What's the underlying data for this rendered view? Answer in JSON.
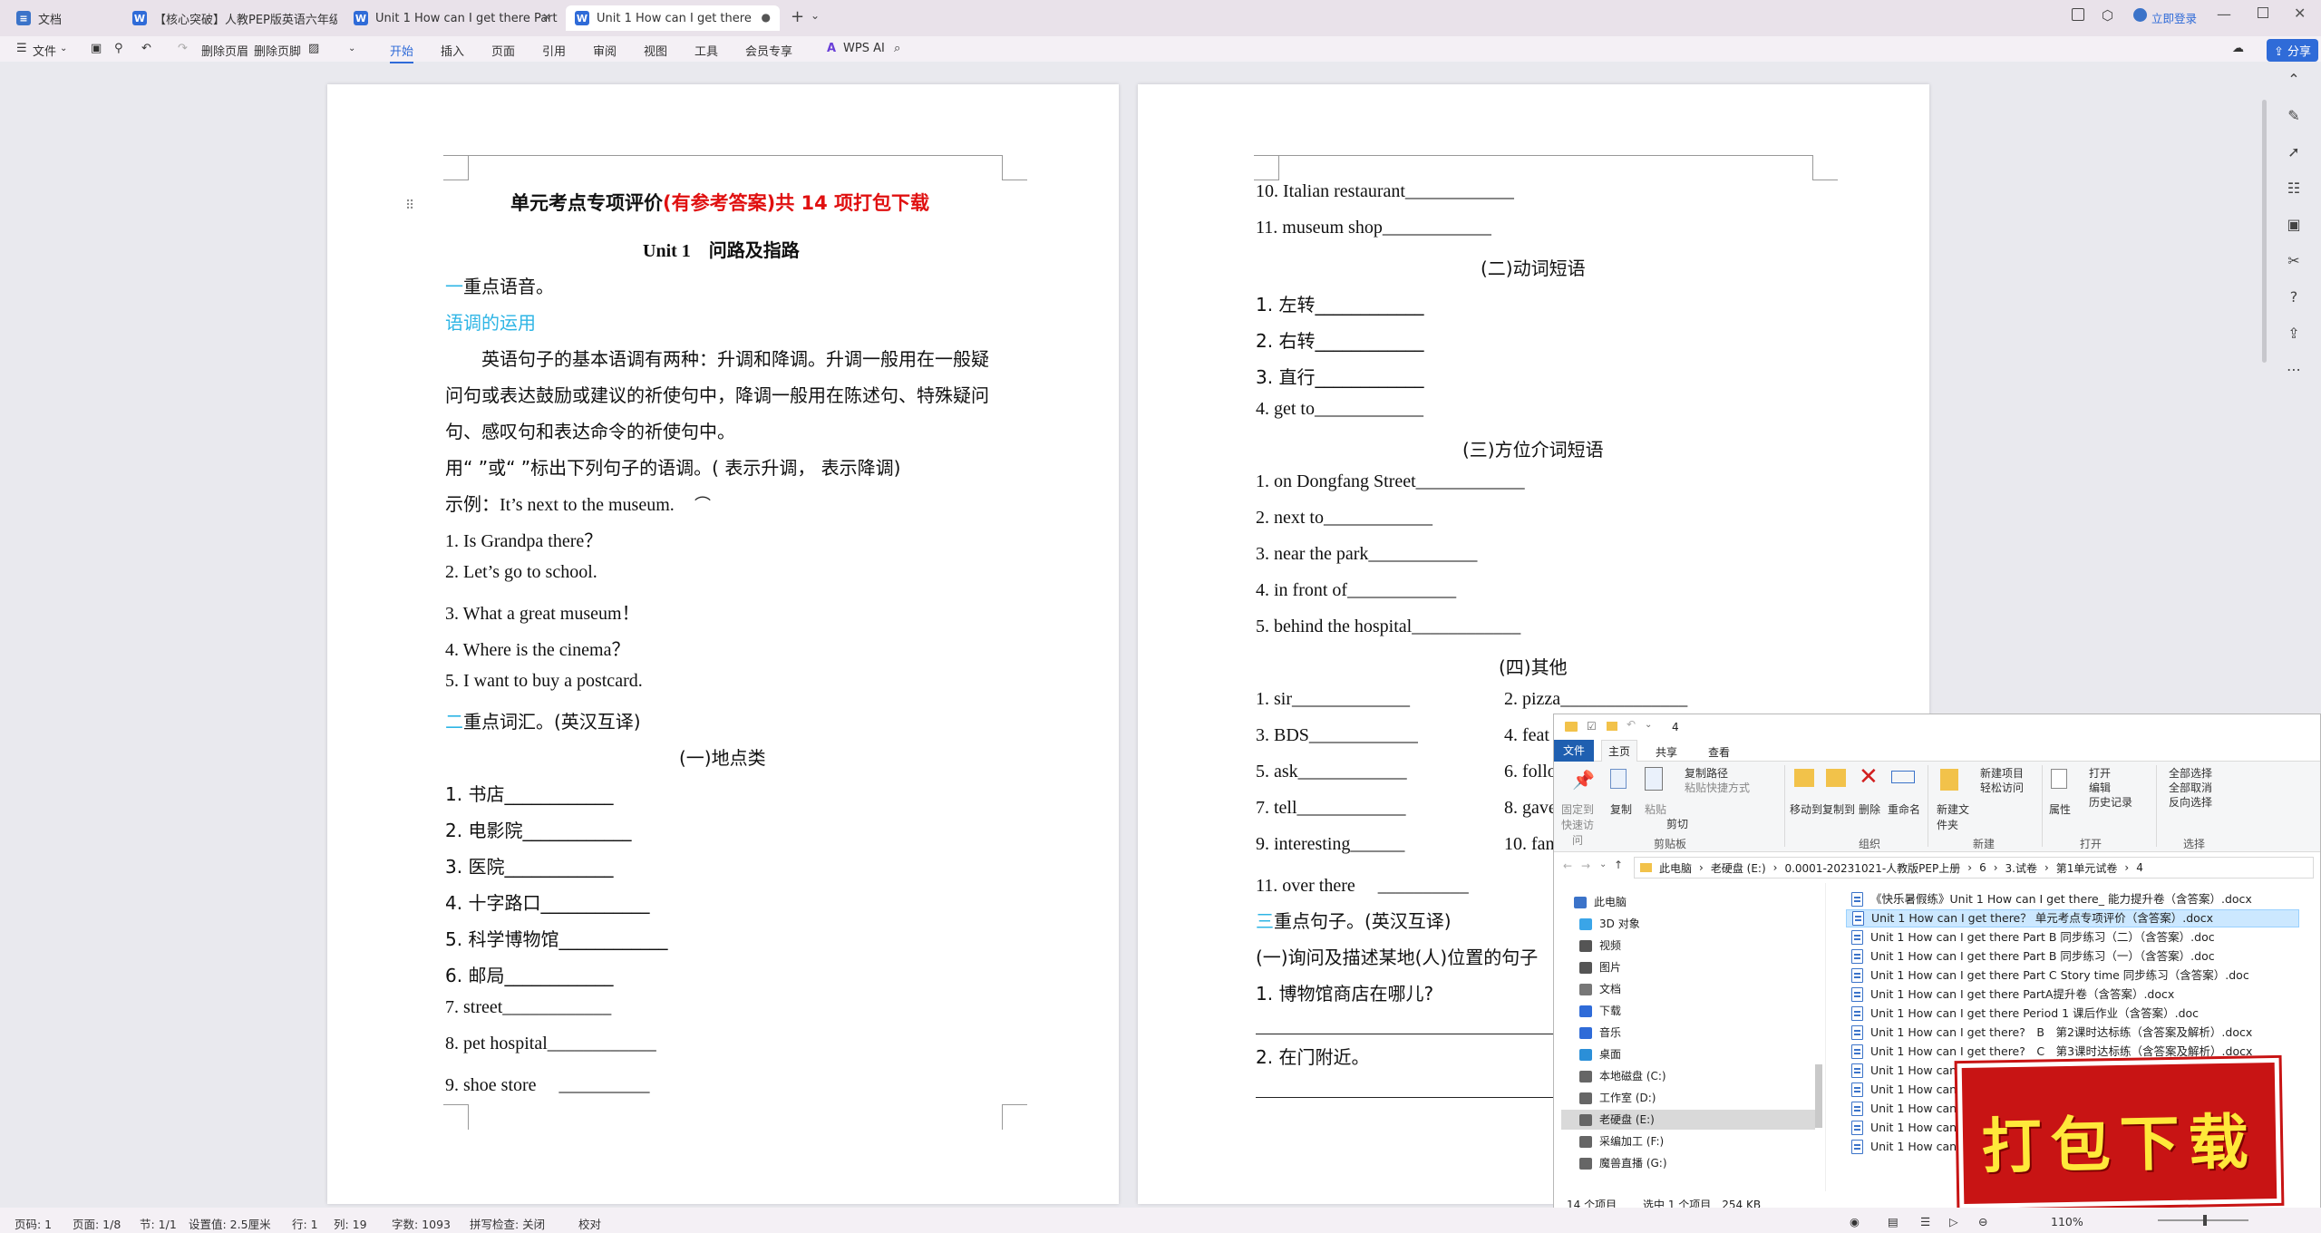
{
  "tabs": [
    {
      "label": "文档",
      "icon": "docs-home-icon",
      "color": "#3b73c9"
    },
    {
      "label": "【核心突破】人教PEP版英语六年级上",
      "icon": "word-doc-icon",
      "color": "#2f6bd8"
    },
    {
      "label": "Unit 1 How can I get there Part",
      "icon": "word-doc-icon",
      "color": "#2f6bd8"
    },
    {
      "label": "Unit 1 How can I get there",
      "icon": "word-doc-icon",
      "color": "#2f6bd8"
    }
  ],
  "title_right": {
    "login": "立即登录",
    "share": "分享"
  },
  "menu": {
    "file": "文件",
    "delete_header": "删除页眉",
    "delete_footer": "删除页脚",
    "tabs": [
      "开始",
      "插入",
      "页面",
      "引用",
      "审阅",
      "视图",
      "工具",
      "会员专享"
    ],
    "wps_ai": "WPS AI"
  },
  "left_page": {
    "title_black": "单元考点专项评价",
    "title_red": "(有参考答案)共 14 项打包下载",
    "unit": "Unit 1　问路及指路",
    "sec1_num": "一",
    "sec1": "重点语音。",
    "intonation": "语调的运用",
    "para1": "英语句子的基本语调有两种：升调和降调。升调一般用在一般疑",
    "para2": "问句或表达鼓励或建议的祈使句中，降调一般用在陈述句、特殊疑问",
    "para3": "句、感叹句和表达命令的祈使句中。",
    "instr": "用“ ”或“ ”标出下列句子的语调。( 表示升调， 表示降调)",
    "example": "示例：It’s next to the museum.",
    "items1": [
      "1. Is Grandpa there？",
      "2. Let’s go to school.",
      "3. What a great museum！",
      "4. Where is the cinema？",
      "5. I want to buy a postcard."
    ],
    "sec2_num": "二",
    "sec2": "重点词汇。(英汉互译)",
    "sub1": "(一)地点类",
    "items2": [
      "1. 书店____________",
      "2. 电影院____________",
      "3. 医院____________",
      "4. 十字路口____________",
      "5. 科学博物馆____________",
      "6. 邮局____________",
      "7. street____________",
      "8. pet hospital____________",
      "9. shoe store　 __________"
    ]
  },
  "right_page": {
    "top": [
      "10. Italian restaurant____________",
      "11. museum shop____________"
    ],
    "sub2": "(二)动词短语",
    "verbs": [
      "1. 左转____________",
      "2. 右转____________",
      "3. 直行____________",
      "4. get to____________"
    ],
    "sub3": "(三)方位介词短语",
    "preps": [
      "1. on Dongfang Street____________",
      "2. next to____________",
      "3. near the park____________",
      "4. in front of____________",
      "5. behind the hospital____________"
    ],
    "sub4": "(四)其他",
    "others_l": [
      "1. sir_____________",
      "3. BDS____________",
      "5. ask____________",
      "7. tell____________",
      "9. interesting______",
      "11. over there　 __________"
    ],
    "others_r": [
      "2. pizza______________",
      "4. feat",
      "6. follo",
      "8. gave",
      "10. fan"
    ],
    "sec3_num": "三",
    "sec3": "重点句子。(英汉互译)",
    "sub5": "(一)询问及描述某地(人)位置的句子",
    "q1": "1. 博物馆商店在哪儿?",
    "q2": "2. 在门附近。"
  },
  "explorer": {
    "title": "4",
    "ribbon_tabs": [
      "文件",
      "主页",
      "共享",
      "查看"
    ],
    "ribbon": {
      "pin": "固定到快速访问",
      "copy": "复制",
      "paste": "粘贴",
      "copy_path": "复制路径",
      "paste_shortcut": "粘贴快捷方式",
      "cut": "剪切",
      "clipboard": "剪贴板",
      "move_to": "移动到",
      "copy_to": "复制到",
      "delete": "删除",
      "rename": "重命名",
      "organize": "组织",
      "new_folder": "新建文件夹",
      "new_item": "新建项目",
      "easy_access": "轻松访问",
      "new": "新建",
      "properties": "属性",
      "open": "打开",
      "edit": "编辑",
      "history": "历史记录",
      "open_grp": "打开",
      "select_all": "全部选择",
      "select_none": "全部取消",
      "invert": "反向选择",
      "select": "选择"
    },
    "breadcrumb": [
      "此电脑",
      "老硬盘 (E:)",
      "0.0001-20231021-人教版PEP上册",
      "6",
      "3.试卷",
      "第1单元试卷",
      "4"
    ],
    "nav": [
      {
        "label": "此电脑",
        "color": "#3b73c9"
      },
      {
        "label": "3D 对象",
        "color": "#3aa5e8"
      },
      {
        "label": "视频",
        "color": "#555"
      },
      {
        "label": "图片",
        "color": "#555"
      },
      {
        "label": "文档",
        "color": "#777"
      },
      {
        "label": "下载",
        "color": "#2f6bd8"
      },
      {
        "label": "音乐",
        "color": "#2f6bd8"
      },
      {
        "label": "桌面",
        "color": "#2b8fd8"
      },
      {
        "label": "本地磁盘 (C:)",
        "color": "#666"
      },
      {
        "label": "工作室 (D:)",
        "color": "#666"
      },
      {
        "label": "老硬盘 (E:)",
        "color": "#666"
      },
      {
        "label": "采编加工 (F:)",
        "color": "#666"
      },
      {
        "label": "魔兽直播 (G:)",
        "color": "#666"
      }
    ],
    "files": [
      "《快乐暑假练》Unit 1 How can I get there_ 能力提升卷（含答案）.docx",
      "Unit 1 How can I get there？ 单元考点专项评价（含答案）.docx",
      "Unit 1 How can I get there Part B 同步练习（二）（含答案）.doc",
      "Unit 1 How can I get there Part B 同步练习（一）（含答案）.doc",
      "Unit 1 How can I get there Part C Story time 同步练习（含答案）.doc",
      "Unit 1 How can I get there PartA提升卷（含答案）.docx",
      "Unit 1 How can I get there Period 1 课后作业（含答案）.doc",
      "Unit 1 How can I get there?　B　第2课时达标练（含答案及解析）.docx",
      "Unit 1 How can I get there?　C　第3课时达标练（含答案及解析）.docx",
      "Unit 1 How can I get",
      "Unit 1 How can I get",
      "Unit 1 How can I get",
      "Unit 1 How can I get",
      "Unit 1 How can I get"
    ],
    "status_count": "14 个项目",
    "status_sel": "选中 1 个项目　254 KB"
  },
  "banner": "打包下载",
  "status": {
    "page": "页码: 1",
    "pages": "页面: 1/8",
    "section": "节: 1/1",
    "setting": "设置值: 2.5厘米",
    "row": "行: 1",
    "col": "列: 19",
    "words": "字数: 1093",
    "spell": "拼写检查: 关闭",
    "proof": "校对",
    "zoom": "110%"
  }
}
